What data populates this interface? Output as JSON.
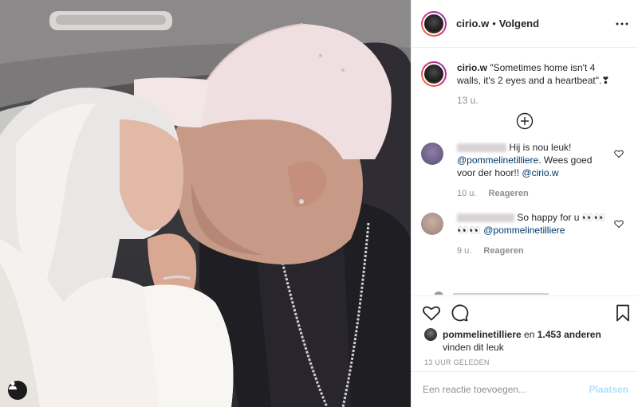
{
  "post": {
    "author": "cirio.w",
    "separator": "•",
    "follow_status": "Volgend",
    "more_icon": "more-horizontal-icon",
    "caption_text": "\"Sometimes home isn't 4 walls, it's 2 eyes and a heartbeat\".❣",
    "caption_time": "13 u.",
    "load_more_icon": "plus-circle-icon"
  },
  "comments": [
    {
      "user_blurred": "ninalggxxxxx",
      "text_1": "Hij is nou leuk!",
      "mention_1": "@pommelinetilliere",
      "text_2": ". Wees goed voor der hoor!!",
      "mention_2": "@cirio.w",
      "time": "10 u.",
      "reply": "Reageren",
      "avatar_color": "#8d7ea6"
    },
    {
      "user_blurred": "deasgmxxxxx",
      "text_1": "So happy for u 👀👀 👀👀",
      "mention_1": "@pommelinetilliere",
      "time": "9 u.",
      "reply": "Reageren",
      "avatar_color": "#b79a8f"
    }
  ],
  "actions": {
    "like_icon": "heart-icon",
    "comment_icon": "comment-icon",
    "save_icon": "bookmark-icon"
  },
  "likes": {
    "user": "pommelinetilliere",
    "connector": "en",
    "count": "1.453 anderen",
    "suffix": "vinden dit leuk"
  },
  "time_ago": "13 UUR GELEDEN",
  "add_comment": {
    "placeholder": "Een reactie toevoegen...",
    "post_label": "Plaatsen"
  },
  "photo": {
    "tag_icon": "user-tag-icon"
  }
}
